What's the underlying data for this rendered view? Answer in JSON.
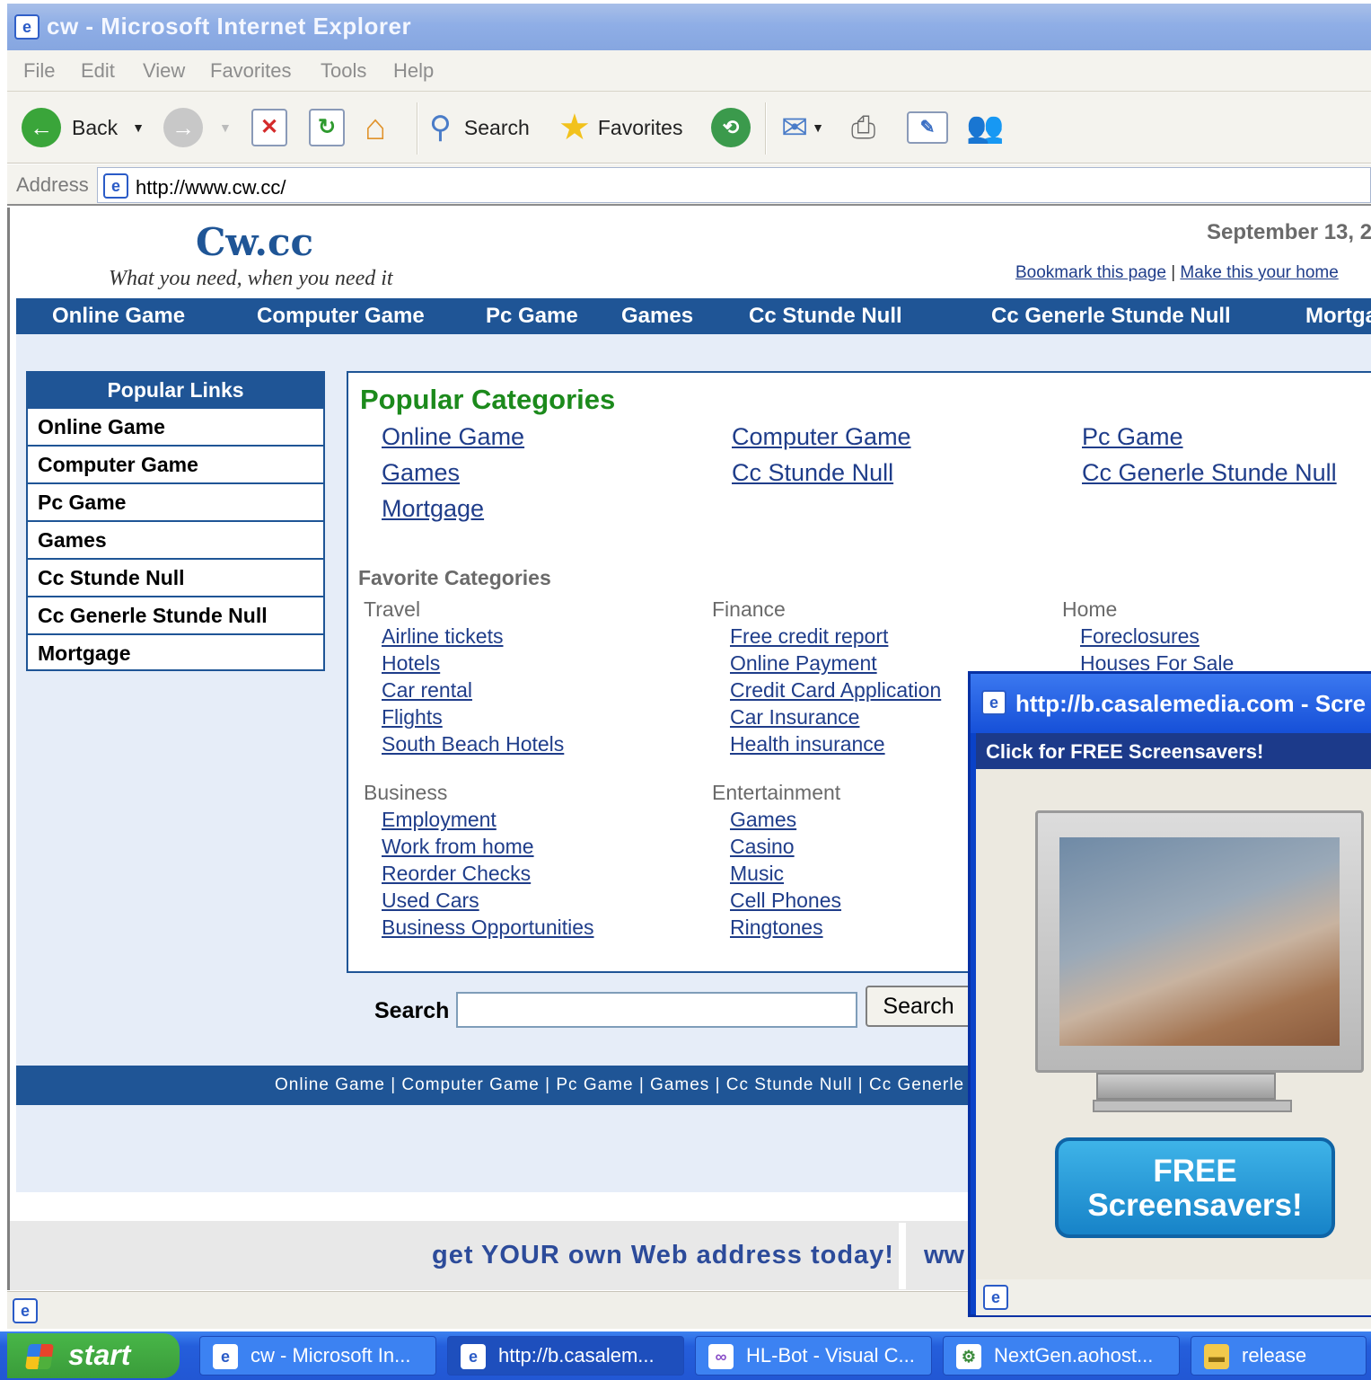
{
  "window": {
    "title": "cw - Microsoft Internet Explorer"
  },
  "menu": [
    "File",
    "Edit",
    "View",
    "Favorites",
    "Tools",
    "Help"
  ],
  "toolbar": {
    "back_label": "Back",
    "search_label": "Search",
    "favorites_label": "Favorites"
  },
  "address": {
    "label": "Address",
    "url": "http://www.cw.cc/"
  },
  "site": {
    "logo": "Cw.cc",
    "tagline": "What you need, when you need it",
    "date": "September 13, 2",
    "bookmark": "Bookmark this page",
    "link_sep": "|",
    "make_home": "Make this your home"
  },
  "nav": [
    "Online Game",
    "Computer Game",
    "Pc Game",
    "Games",
    "Cc Stunde Null",
    "Cc Generle Stunde Null",
    "Mortga"
  ],
  "sidebar": {
    "title": "Popular Links",
    "items": [
      "Online Game",
      "Computer Game",
      "Pc Game",
      "Games",
      "Cc Stunde Null",
      "Cc Generle Stunde Null",
      "Mortgage"
    ]
  },
  "popular": {
    "title": "Popular Categories",
    "links": [
      "Online Game",
      "Computer Game",
      "Pc Game",
      "Games",
      "Cc Stunde Null",
      "Cc Generle Stunde Null",
      "Mortgage"
    ]
  },
  "favorite": {
    "title": "Favorite Categories",
    "travel": {
      "label": "Travel",
      "links": [
        "Airline tickets",
        "Hotels",
        "Car rental",
        "Flights",
        "South Beach Hotels"
      ]
    },
    "finance": {
      "label": "Finance",
      "links": [
        "Free credit report",
        "Online Payment",
        "Credit Card Application",
        "Car Insurance",
        "Health insurance"
      ]
    },
    "home": {
      "label": "Home",
      "links": [
        "Foreclosures",
        "Houses For Sale"
      ]
    },
    "business": {
      "label": "Business",
      "links": [
        "Employment",
        "Work from home",
        "Reorder Checks",
        "Used Cars",
        "Business Opportunities"
      ]
    },
    "entertainment": {
      "label": "Entertainment",
      "links": [
        "Games",
        "Casino",
        "Music",
        "Cell Phones",
        "Ringtones"
      ]
    }
  },
  "search": {
    "label": "Search",
    "button": "Search"
  },
  "footer_nav": "Online Game | Computer Game | Pc Game | Games | Cc Stunde Null | Cc Generle",
  "promo": {
    "text": "get YOUR own Web address today!",
    "text2": "ww"
  },
  "popup": {
    "title": "http://b.casalemedia.com - Scre",
    "header": "Click for FREE Screensavers!",
    "button_line1": "FREE",
    "button_line2": "Screensavers!"
  },
  "taskbar": {
    "start": "start",
    "tasks": [
      "cw - Microsoft In...",
      "http://b.casalem...",
      "HL-Bot - Visual C...",
      "NextGen.aohost...",
      "release"
    ]
  },
  "colors": {
    "brand": "#1f5596",
    "popular_green": "#1c8a1c",
    "link": "#1f3d8a",
    "xp_blue": "#245edb"
  }
}
